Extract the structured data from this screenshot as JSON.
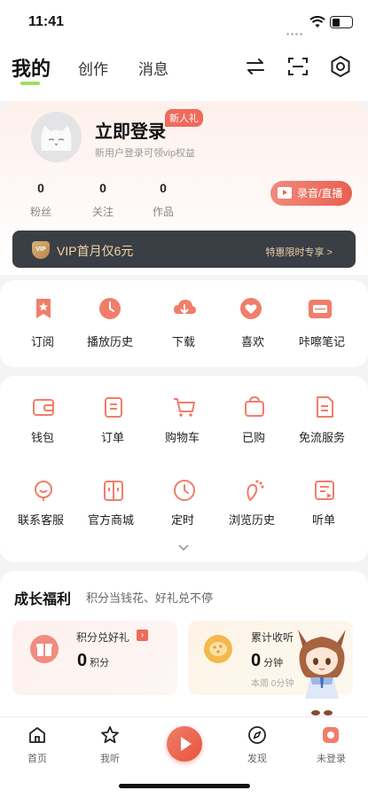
{
  "status_bar": {
    "time": "11:41"
  },
  "nav": {
    "tabs": [
      "我的",
      "创作",
      "消息"
    ],
    "active_tab": "我的"
  },
  "profile": {
    "login_title": "立即登录",
    "new_badge": "新人礼",
    "login_subtitle": "新用户登录可领vip权益",
    "stats": [
      {
        "value": "0",
        "label": "粉丝"
      },
      {
        "value": "0",
        "label": "关注"
      },
      {
        "value": "0",
        "label": "作品"
      }
    ],
    "record_button": "录音/直播"
  },
  "vip": {
    "badge": "VIP",
    "text": "VIP首月仅6元",
    "offer": "特惠限时专享 >"
  },
  "quick_actions": [
    {
      "label": "订阅",
      "icon": "subscribe-icon"
    },
    {
      "label": "播放历史",
      "icon": "history-icon"
    },
    {
      "label": "下载",
      "icon": "download-icon"
    },
    {
      "label": "喜欢",
      "icon": "heart-icon"
    },
    {
      "label": "咔嚓笔记",
      "icon": "note-icon"
    }
  ],
  "services": [
    {
      "label": "钱包",
      "icon": "wallet-icon"
    },
    {
      "label": "订单",
      "icon": "order-icon"
    },
    {
      "label": "购物车",
      "icon": "cart-icon"
    },
    {
      "label": "已购",
      "icon": "bag-icon"
    },
    {
      "label": "免流服务",
      "icon": "data-free-icon"
    },
    {
      "label": "联系客服",
      "icon": "support-icon"
    },
    {
      "label": "官方商城",
      "icon": "mall-icon"
    },
    {
      "label": "定时",
      "icon": "timer-icon"
    },
    {
      "label": "浏览历史",
      "icon": "footprint-icon"
    },
    {
      "label": "听单",
      "icon": "playlist-icon"
    }
  ],
  "welfare": {
    "title": "成长福利",
    "subtitle": "积分当钱花、好礼兑不停",
    "points": {
      "title": "积分兑好礼",
      "value": "0",
      "unit": "积分"
    },
    "listening": {
      "title": "累计收听",
      "value": "0",
      "unit": "分钟",
      "weekly": "本周 0分钟"
    }
  },
  "bottom_tabs": [
    {
      "label": "首页",
      "icon": "home-icon"
    },
    {
      "label": "我听",
      "icon": "star-icon"
    },
    {
      "label": "发现",
      "icon": "discover-icon"
    },
    {
      "label": "未登录",
      "icon": "profile-icon"
    }
  ],
  "colors": {
    "accent": "#e9604f",
    "vip_bar": "#3a3e45",
    "vip_text": "#f3d5a5",
    "active_underline": "#9be15d"
  }
}
